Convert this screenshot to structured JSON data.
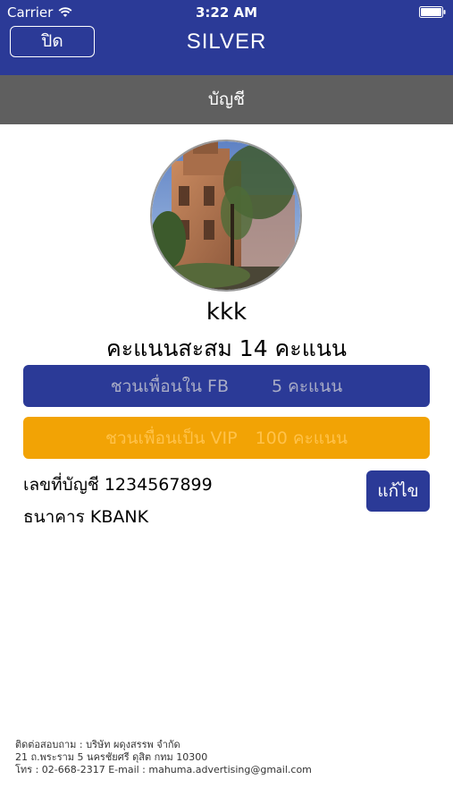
{
  "status_bar": {
    "carrier": "Carrier",
    "time": "3:22 AM"
  },
  "header": {
    "close_label": "ปิด",
    "title": "SILVER"
  },
  "section": {
    "title": "บัญชี"
  },
  "profile": {
    "username": "kkk",
    "points_text": "คะแนนสะสม 14 คะแนน"
  },
  "invite_fb": {
    "label": "ชวนเพื่อนใน FB",
    "points": "5 คะแนน"
  },
  "invite_vip": {
    "label": "ชวนเพื่อนเป็น VIP",
    "points": "100 คะแนน"
  },
  "account": {
    "number_text": "เลขที่บัญชี 1234567899",
    "bank_text": "ธนาคาร KBANK",
    "edit_label": "แก้ไข"
  },
  "footer": {
    "line1": "ติดต่อสอบถาม : บริษัท ผดุงสรรพ จำกัด",
    "line2": "21 ถ.พระราม 5 นครชัยศรี ดุสิต กทม 10300",
    "line3": "โทร : 02-668-2317 E-mail : mahuma.advertising@gmail.com"
  },
  "colors": {
    "primary": "#2b3a97",
    "section_bar": "#5f5f5f",
    "vip_button": "#f2a305"
  },
  "icons": {
    "wifi": "wifi-icon",
    "battery": "battery-icon"
  }
}
